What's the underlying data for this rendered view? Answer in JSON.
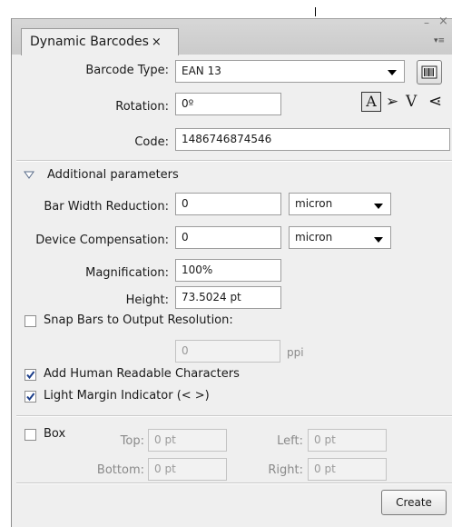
{
  "panel": {
    "tab_title": "Dynamic Barcodes",
    "tab_close": "×",
    "min_glyph": "–",
    "close_glyph": "×",
    "menu_glyph": "▾≡"
  },
  "barcode": {
    "type_label": "Barcode Type:",
    "type_value": "EAN 13",
    "rotation_label": "Rotation:",
    "rotation_value": "0º",
    "code_label": "Code:",
    "code_value": "1486746874546",
    "orientation_glyphs": [
      "A",
      "➢",
      "V",
      "⋖"
    ]
  },
  "additional": {
    "header": "Additional parameters",
    "bar_width_label": "Bar Width Reduction:",
    "bar_width_value": "0",
    "bar_width_unit": "micron",
    "device_comp_label": "Device Compensation:",
    "device_comp_value": "0",
    "device_comp_unit": "micron",
    "magnification_label": "Magnification:",
    "magnification_value": "100%",
    "height_label": "Height:",
    "height_value": "73.5024 pt",
    "snap_label": "Snap Bars to Output Resolution:",
    "snap_checked": false,
    "resolution_value": "0",
    "resolution_unit": "ppi",
    "human_readable_label": "Add Human Readable Characters",
    "human_readable_checked": true,
    "light_margin_label": "Light Margin Indicator (< >)",
    "light_margin_checked": true
  },
  "box": {
    "label": "Box",
    "checked": false,
    "top_label": "Top:",
    "top_value": "0 pt",
    "left_label": "Left:",
    "left_value": "0 pt",
    "bottom_label": "Bottom:",
    "bottom_value": "0 pt",
    "right_label": "Right:",
    "right_value": "0 pt"
  },
  "actions": {
    "create_label": "Create"
  }
}
